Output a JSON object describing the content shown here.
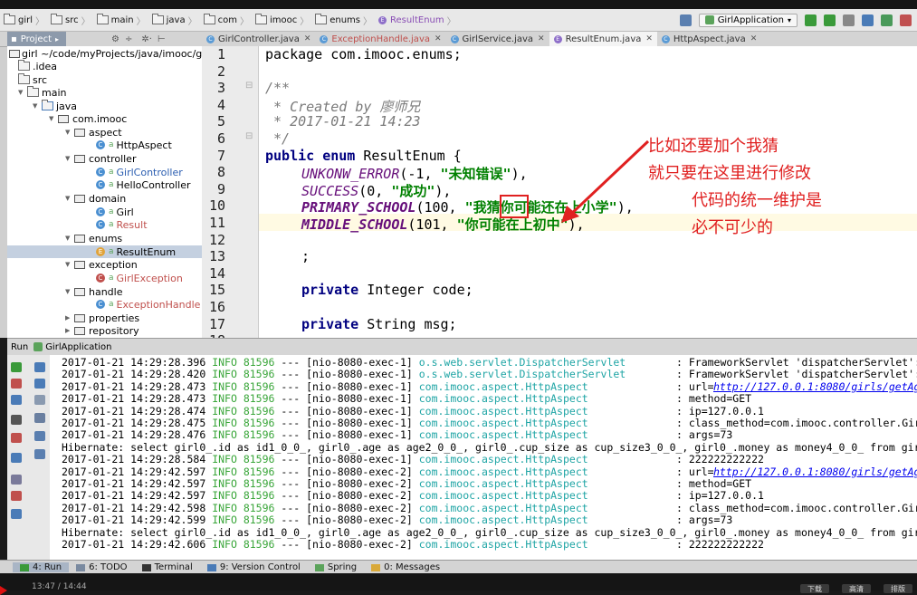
{
  "breadcrumbs": [
    "girl",
    "src",
    "main",
    "java",
    "com",
    "imooc",
    "enums",
    "ResultEnum"
  ],
  "run_config": "GirlApplication",
  "project": {
    "tab_label": "Project",
    "root": "girl ~/code/myProjects/java/imooc/g",
    "items": [
      ".idea",
      "src",
      "main",
      "java",
      "com.imooc",
      "aspect",
      "HttpAspect",
      "controller",
      "GirlController",
      "HelloController",
      "domain",
      "Girl",
      "Result",
      "enums",
      "ResultEnum",
      "exception",
      "GirlException",
      "handle",
      "ExceptionHandle",
      "properties",
      "repository"
    ]
  },
  "editor_tabs": [
    "GirlController.java",
    "ExceptionHandle.java",
    "GirlService.java",
    "ResultEnum.java",
    "HttpAspect.java"
  ],
  "line_numbers": [
    "1",
    "2",
    "3",
    "4",
    "5",
    "6",
    "7",
    "8",
    "9",
    "10",
    "11",
    "12",
    "13",
    "14",
    "15",
    "16",
    "17",
    "18"
  ],
  "code": {
    "l1": "package com.imooc.enums;",
    "l3": "/**",
    "l4": " * Created by 廖师兄",
    "l5": " * 2017-01-21 14:23",
    "l6": " */",
    "l7a": "public enum ",
    "l7b": "ResultEnum {",
    "l8a": "UNKONW_ERROR",
    "l8b": "(-1, ",
    "l8c": "\"未知错误\"",
    "l8d": "),",
    "l9a": "SUCCESS",
    "l9b": "(0, ",
    "l9c": "\"成功\"",
    "l9d": "),",
    "l10a": "PRIMARY_SCHOOL",
    "l10b": "(100, ",
    "l10c": "\"我猜你可能还在上小学\"",
    "l10d": "),",
    "l11a": "MIDDLE_SCHOOL",
    "l11b": "(101, ",
    "l11c": "\"你可能在上初中\"",
    "l11d": "),",
    "l13": ";",
    "l15a": "private ",
    "l15b": "Integer code;",
    "l17a": "private ",
    "l17b": "String msg;"
  },
  "annotation": [
    "比如还要加个我猜",
    "就只要在这里进行修改",
    "代码的统一维护是",
    "必不可少的"
  ],
  "run_panel": {
    "label": "Run",
    "config": "GirlApplication"
  },
  "console": [
    {
      "ts": "2017-01-21 14:29:28.396",
      "lvl": "INFO",
      "pid": "81596",
      "thr": "--- [nio-8080-exec-1]",
      "cls": "o.s.web.servlet.DispatcherServlet",
      "msg": ": FrameworkServlet 'dispatcherServlet':"
    },
    {
      "ts": "2017-01-21 14:29:28.420",
      "lvl": "INFO",
      "pid": "81596",
      "thr": "--- [nio-8080-exec-1]",
      "cls": "o.s.web.servlet.DispatcherServlet",
      "msg": ": FrameworkServlet 'dispatcherServlet':"
    },
    {
      "ts": "2017-01-21 14:29:28.473",
      "lvl": "INFO",
      "pid": "81596",
      "thr": "--- [nio-8080-exec-1]",
      "cls": "com.imooc.aspect.HttpAspect",
      "msg": ": url=",
      "link": "http://127.0.0.1:8080/girls/getAg"
    },
    {
      "ts": "2017-01-21 14:29:28.473",
      "lvl": "INFO",
      "pid": "81596",
      "thr": "--- [nio-8080-exec-1]",
      "cls": "com.imooc.aspect.HttpAspect",
      "msg": ": method=GET"
    },
    {
      "ts": "2017-01-21 14:29:28.474",
      "lvl": "INFO",
      "pid": "81596",
      "thr": "--- [nio-8080-exec-1]",
      "cls": "com.imooc.aspect.HttpAspect",
      "msg": ": ip=127.0.0.1"
    },
    {
      "ts": "2017-01-21 14:29:28.475",
      "lvl": "INFO",
      "pid": "81596",
      "thr": "--- [nio-8080-exec-1]",
      "cls": "com.imooc.aspect.HttpAspect",
      "msg": ": class_method=com.imooc.controller.Gir"
    },
    {
      "ts": "2017-01-21 14:29:28.476",
      "lvl": "INFO",
      "pid": "81596",
      "thr": "--- [nio-8080-exec-1]",
      "cls": "com.imooc.aspect.HttpAspect",
      "msg": ": args=73"
    },
    {
      "plain": "Hibernate: select girl0_.id as id1_0_0_, girl0_.age as age2_0_0_, girl0_.cup_size as cup_size3_0_0_, girl0_.money as money4_0_0_ from girl"
    },
    {
      "ts": "2017-01-21 14:29:28.584",
      "lvl": "INFO",
      "pid": "81596",
      "thr": "--- [nio-8080-exec-1]",
      "cls": "com.imooc.aspect.HttpAspect",
      "msg": ": 222222222222"
    },
    {
      "ts": "2017-01-21 14:29:42.597",
      "lvl": "INFO",
      "pid": "81596",
      "thr": "--- [nio-8080-exec-2]",
      "cls": "com.imooc.aspect.HttpAspect",
      "msg": ": url=",
      "link": "http://127.0.0.1:8080/girls/getAg"
    },
    {
      "ts": "2017-01-21 14:29:42.597",
      "lvl": "INFO",
      "pid": "81596",
      "thr": "--- [nio-8080-exec-2]",
      "cls": "com.imooc.aspect.HttpAspect",
      "msg": ": method=GET"
    },
    {
      "ts": "2017-01-21 14:29:42.597",
      "lvl": "INFO",
      "pid": "81596",
      "thr": "--- [nio-8080-exec-2]",
      "cls": "com.imooc.aspect.HttpAspect",
      "msg": ": ip=127.0.0.1"
    },
    {
      "ts": "2017-01-21 14:29:42.598",
      "lvl": "INFO",
      "pid": "81596",
      "thr": "--- [nio-8080-exec-2]",
      "cls": "com.imooc.aspect.HttpAspect",
      "msg": ": class_method=com.imooc.controller.Gir"
    },
    {
      "ts": "2017-01-21 14:29:42.599",
      "lvl": "INFO",
      "pid": "81596",
      "thr": "--- [nio-8080-exec-2]",
      "cls": "com.imooc.aspect.HttpAspect",
      "msg": ": args=73"
    },
    {
      "plain": "Hibernate: select girl0_.id as id1_0_0_, girl0_.age as age2_0_0_, girl0_.cup_size as cup_size3_0_0_, girl0_.money as money4_0_0_ from girl"
    },
    {
      "ts": "2017-01-21 14:29:42.606",
      "lvl": "INFO",
      "pid": "81596",
      "thr": "--- [nio-8080-exec-2]",
      "cls": "com.imooc.aspect.HttpAspect",
      "msg": ": 222222222222"
    }
  ],
  "bottom_tools": [
    "4: Run",
    "6: TODO",
    "Terminal",
    "9: Version Control",
    "Spring",
    "0: Messages"
  ],
  "player": {
    "time": "13:47 / 14:44",
    "buttons": [
      "下载",
      "高清",
      "排版"
    ]
  },
  "colors": {
    "annotation": "#e02020",
    "keyword": "#000080",
    "enum_field": "#660e7a",
    "string": "#008000",
    "log_info": "#3aa63a",
    "log_class": "#1fa5a5"
  }
}
